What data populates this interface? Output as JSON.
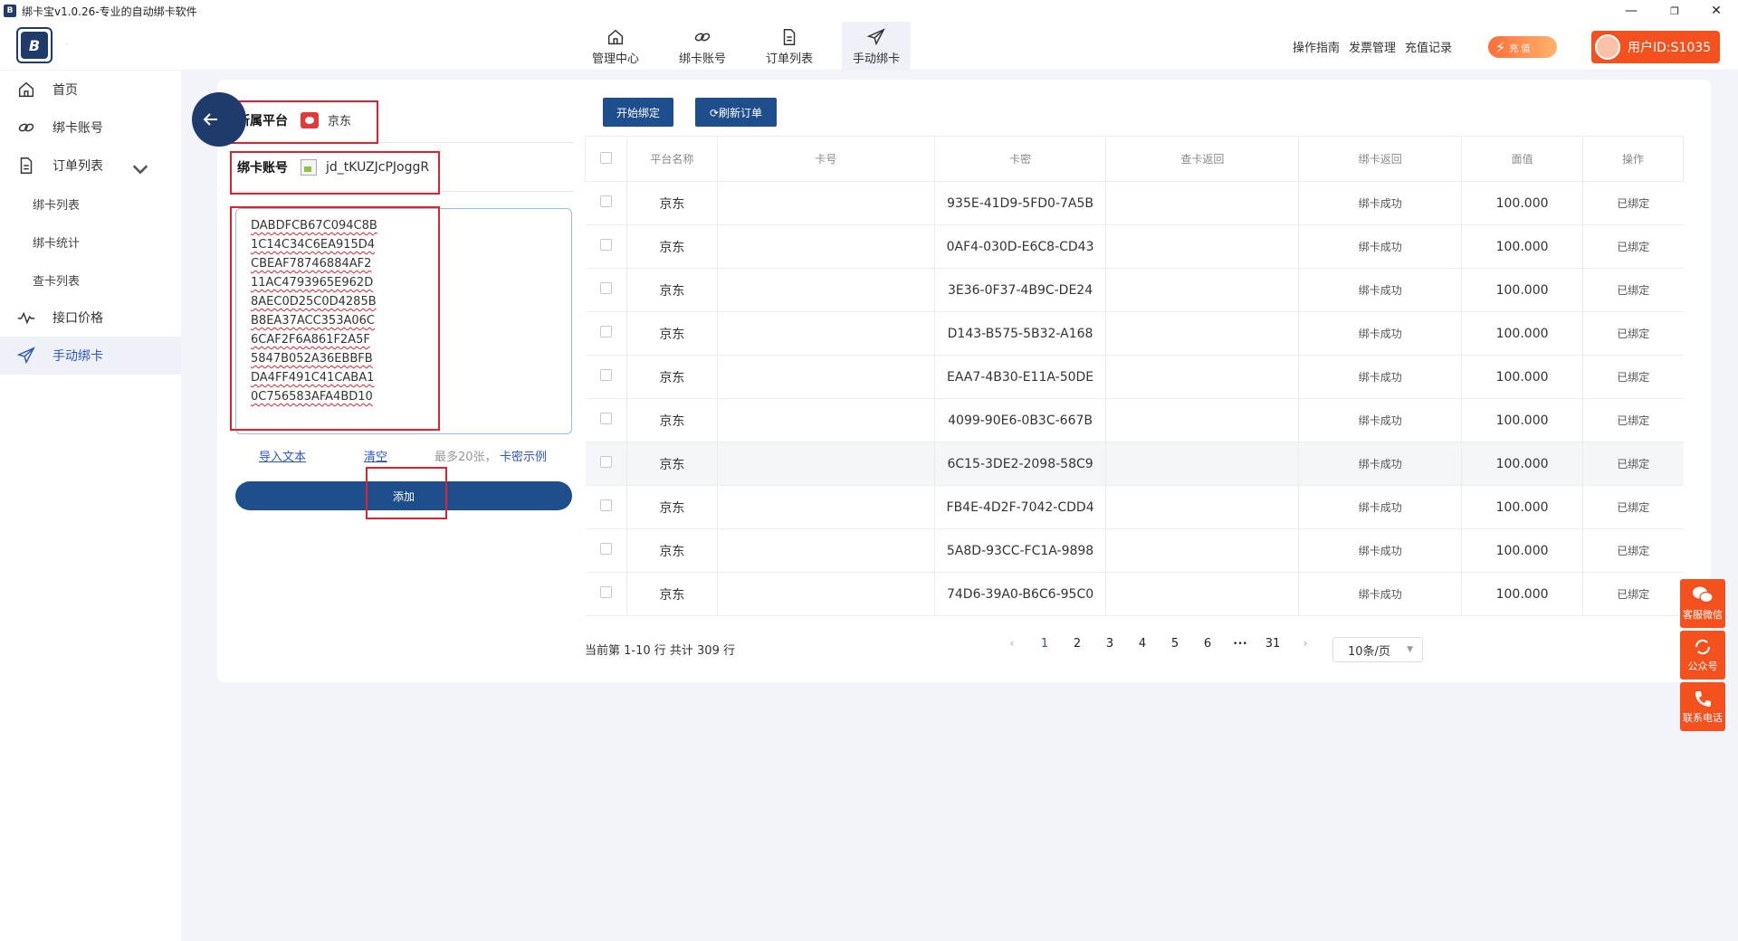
{
  "window": {
    "title": "绑卡宝v1.0.26-专业的自动绑卡软件",
    "minimize": "—",
    "restore": "❐",
    "close": "✕"
  },
  "logo": {
    "text": "B",
    "dot": "·"
  },
  "topnav": [
    {
      "label": "管理中心",
      "icon": "home-icon"
    },
    {
      "label": "绑卡账号",
      "icon": "link-icon"
    },
    {
      "label": "订单列表",
      "icon": "document-icon"
    },
    {
      "label": "手动绑卡",
      "icon": "send-icon"
    }
  ],
  "header_links": [
    "操作指南",
    "发票管理",
    "充值记录"
  ],
  "recharge": {
    "label": "充 值"
  },
  "user": {
    "label": "用户ID:S1035"
  },
  "sidebar": {
    "home": "首页",
    "accounts": "绑卡账号",
    "orders": "订单列表",
    "sub": [
      "绑卡列表",
      "绑卡统计",
      "查卡列表"
    ],
    "api_price": "接口价格",
    "manual": "手动绑卡"
  },
  "form": {
    "platform_label": "所属平台",
    "platform_value": "京东",
    "account_label": "绑卡账号",
    "account_value": "jd_tKUZJcPJoggR",
    "cards": [
      "DABDFCB67C094C8B",
      "1C14C34C6EA915D4",
      "CBEAF78746884AF2",
      "11AC4793965E962D",
      "8AEC0D25C0D4285B",
      "B8EA37ACC353A06C",
      "6CAF2F6A861F2A5F",
      "5847B052A36EBBFB",
      "DA4FF491C41CABA1",
      "0C756583AFA4BD10"
    ],
    "import_text": "导入文本",
    "clear": "清空",
    "hint": "最多20张，",
    "example": "卡密示例",
    "add": "添加"
  },
  "toolbar": {
    "start": "开始绑定",
    "refresh": "⟳刷新订单"
  },
  "table": {
    "headers": [
      "平台名称",
      "卡号",
      "卡密",
      "查卡返回",
      "绑卡返回",
      "面值",
      "操作"
    ],
    "rows": [
      {
        "platform": "京东",
        "cardno": "",
        "secret": "935E-41D9-5FD0-7A5B",
        "check": "",
        "bind": "绑卡成功",
        "value": "100.000",
        "op": "已绑定"
      },
      {
        "platform": "京东",
        "cardno": "",
        "secret": "0AF4-030D-E6C8-CD43",
        "check": "",
        "bind": "绑卡成功",
        "value": "100.000",
        "op": "已绑定"
      },
      {
        "platform": "京东",
        "cardno": "",
        "secret": "3E36-0F37-4B9C-DE24",
        "check": "",
        "bind": "绑卡成功",
        "value": "100.000",
        "op": "已绑定"
      },
      {
        "platform": "京东",
        "cardno": "",
        "secret": "D143-B575-5B32-A168",
        "check": "",
        "bind": "绑卡成功",
        "value": "100.000",
        "op": "已绑定"
      },
      {
        "platform": "京东",
        "cardno": "",
        "secret": "EAA7-4B30-E11A-50DE",
        "check": "",
        "bind": "绑卡成功",
        "value": "100.000",
        "op": "已绑定"
      },
      {
        "platform": "京东",
        "cardno": "",
        "secret": "4099-90E6-0B3C-667B",
        "check": "",
        "bind": "绑卡成功",
        "value": "100.000",
        "op": "已绑定"
      },
      {
        "platform": "京东",
        "cardno": "",
        "secret": "6C15-3DE2-2098-58C9",
        "check": "",
        "bind": "绑卡成功",
        "value": "100.000",
        "op": "已绑定"
      },
      {
        "platform": "京东",
        "cardno": "",
        "secret": "FB4E-4D2F-7042-CDD4",
        "check": "",
        "bind": "绑卡成功",
        "value": "100.000",
        "op": "已绑定"
      },
      {
        "platform": "京东",
        "cardno": "",
        "secret": "5A8D-93CC-FC1A-9898",
        "check": "",
        "bind": "绑卡成功",
        "value": "100.000",
        "op": "已绑定"
      },
      {
        "platform": "京东",
        "cardno": "",
        "secret": "74D6-39A0-B6C6-95C0",
        "check": "",
        "bind": "绑卡成功",
        "value": "100.000",
        "op": "已绑定"
      }
    ]
  },
  "pagination": {
    "info": "当前第 1-10 行  共计 309 行",
    "prev": "‹",
    "pages": [
      "1",
      "2",
      "3",
      "4",
      "5",
      "6",
      "•••",
      "31"
    ],
    "next": "›",
    "page_size": "10条/页"
  },
  "float": {
    "wechat": "客服微信",
    "official": "公众号",
    "phone": "联系电话"
  },
  "colors": {
    "primary": "#1f4e8c",
    "accent": "#f4511e",
    "highlight": "#e0212e",
    "active_link": "#2b56c4"
  }
}
